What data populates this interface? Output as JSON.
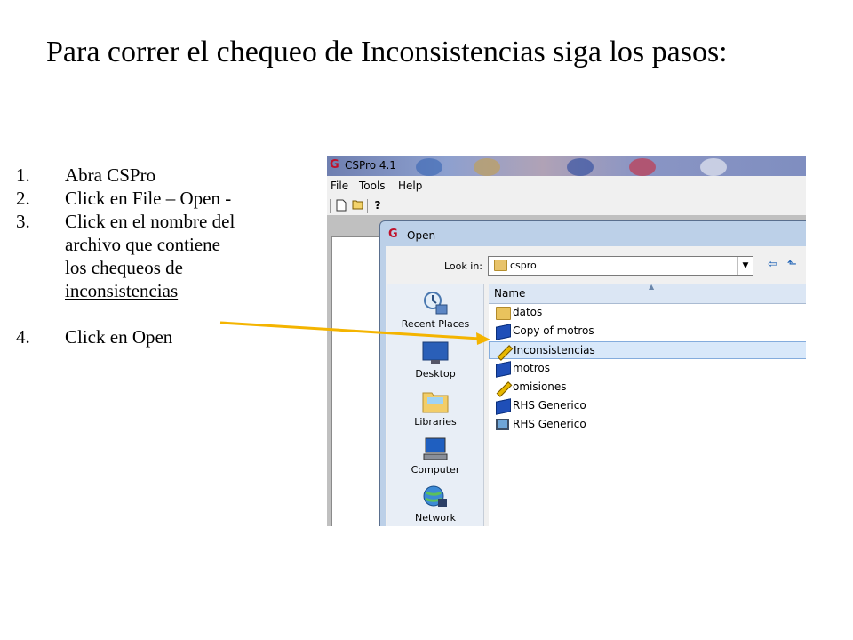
{
  "slide": {
    "title": "Para correr el chequeo de Inconsistencias siga los pasos:",
    "steps": [
      {
        "num": "1.",
        "text": "Abra CSPro"
      },
      {
        "num": "2.",
        "text": "Click en File – Open  -"
      },
      {
        "num": "3.",
        "text_lines": [
          "Click en el nombre del",
          "archivo que contiene",
          "los chequeos de",
          "inconsistencias"
        ]
      },
      {
        "num": "4.",
        "text": "Click en Open"
      }
    ],
    "arrow_color": "#f4b400"
  },
  "app": {
    "title": "CSPro 4.1",
    "menu": [
      "File",
      "Tools",
      "Help"
    ],
    "toolbar_icons": [
      "new-file-icon",
      "open-folder-icon",
      "help-icon"
    ]
  },
  "dialog": {
    "title": "Open",
    "look_in_label": "Look in:",
    "look_in_value": "cspro",
    "places": [
      {
        "label": "Recent Places",
        "icon": "recent-places-icon"
      },
      {
        "label": "Desktop",
        "icon": "desktop-icon"
      },
      {
        "label": "Libraries",
        "icon": "libraries-icon"
      },
      {
        "label": "Computer",
        "icon": "computer-icon"
      },
      {
        "label": "Network",
        "icon": "network-icon"
      }
    ],
    "column_header": "Name",
    "files": [
      {
        "name": "datos",
        "icon": "folder-icon",
        "selected": false
      },
      {
        "name": "Copy of motros",
        "icon": "dictionary-book-icon",
        "selected": false
      },
      {
        "name": "Inconsistencias",
        "icon": "pencil-icon",
        "selected": true
      },
      {
        "name": "motros",
        "icon": "dictionary-book-icon",
        "selected": false
      },
      {
        "name": "omisiones",
        "icon": "pencil-icon",
        "selected": false
      },
      {
        "name": "RHS Generico",
        "icon": "dictionary-book-icon",
        "selected": false
      },
      {
        "name": "RHS Generico",
        "icon": "monitor-icon",
        "selected": false
      }
    ]
  },
  "colors": {
    "selection_bg": "#d8e8fa",
    "selection_border": "#84acdd",
    "dialog_frame": "#bcd0e8"
  }
}
